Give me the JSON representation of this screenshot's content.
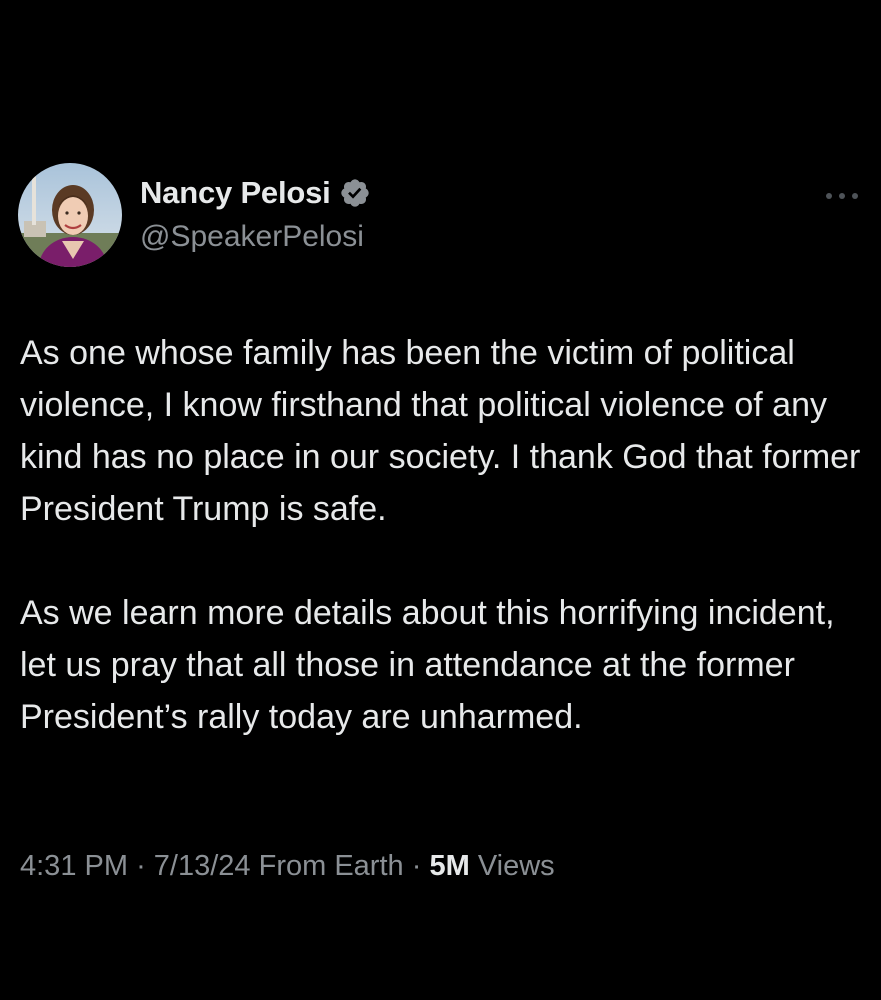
{
  "tweet": {
    "author": {
      "display_name": "Nancy Pelosi",
      "handle": "@SpeakerPelosi",
      "verified": true,
      "verified_badge_color": "#8b9095"
    },
    "more_icon": "more-horizontal-icon",
    "paragraphs": [
      "As one whose family has been the victim of political violence, I know firsthand that political violence of any kind has no place in our society. I thank God that former President Trump is safe.",
      "As we learn more details about this horrifying incident, let us pray that all those in attendance at the former President’s rally today are unharmed."
    ],
    "meta": {
      "time": "4:31 PM",
      "separator": "·",
      "date": "7/13/24",
      "source": "From Earth",
      "views_count": "5M",
      "views_label": "Views"
    }
  },
  "colors": {
    "background": "#000000",
    "primary_text": "#e7e9ea",
    "secondary_text": "#8b9095"
  }
}
